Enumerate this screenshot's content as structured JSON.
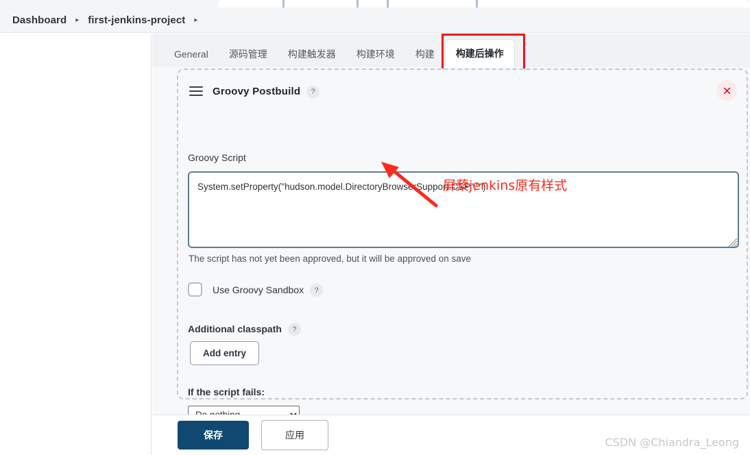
{
  "breadcrumb": {
    "items": [
      {
        "label": "Dashboard"
      },
      {
        "label": "first-jenkins-project"
      }
    ],
    "separator": "▸"
  },
  "tabs": [
    {
      "label": "General",
      "active": false
    },
    {
      "label": "源码管理",
      "active": false
    },
    {
      "label": "构建触发器",
      "active": false
    },
    {
      "label": "构建环境",
      "active": false
    },
    {
      "label": "构建",
      "active": false
    },
    {
      "label": "构建后操作",
      "active": true
    }
  ],
  "card": {
    "title": "Groovy Postbuild",
    "help_label": "?",
    "drag_handle_icon": "drag-handle-icon",
    "close_icon": "close-icon"
  },
  "form": {
    "script_label": "Groovy Script",
    "script_value": "System.setProperty(\"hudson.model.DirectoryBrowserSupport.CSP\",\"\")",
    "script_placeholder": "",
    "approval_note": "The script has not yet been approved, but it will be approved on save",
    "sandbox_label": "Use Groovy Sandbox",
    "sandbox_checked": false,
    "sandbox_help": "?",
    "classpath_label": "Additional classpath",
    "classpath_help": "?",
    "add_entry_label": "Add entry",
    "fails_label": "If the script fails:",
    "fails_selected": "Do nothing",
    "fails_options": [
      "Do nothing"
    ]
  },
  "annotation": {
    "text": "屏蔾jenkins原有样式",
    "color": "#fa2a1e",
    "arrow_icon": "arrow-up-left-icon",
    "tab_highlight_color": "#fc0d1b"
  },
  "actions": {
    "save_label": "保存",
    "apply_label": "应用",
    "save_color": "#0f4871"
  },
  "watermark": "CSDN @Chiandra_Leong"
}
